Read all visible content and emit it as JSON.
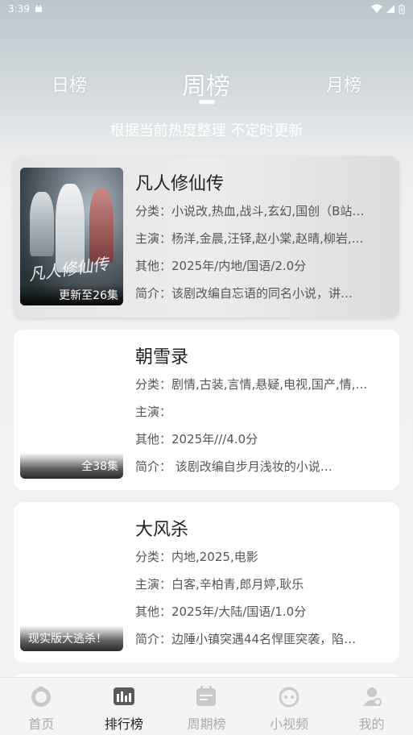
{
  "status": {
    "time": "3:39"
  },
  "tabs": [
    {
      "label": "日榜",
      "active": false
    },
    {
      "label": "周榜",
      "active": true
    },
    {
      "label": "月榜",
      "active": false
    }
  ],
  "subtitle": "根据当前热度整理 不定时更新",
  "cards": [
    {
      "title": "凡人修仙传",
      "badge": "更新至26集",
      "poster_art_text": "凡人修仙传",
      "category": "分类：小说改,热血,战斗,玄幻,国创（B站…",
      "cast": "主演：杨洋,金晨,汪铎,赵小棠,赵晴,柳岩,…",
      "other": "其他：2025年/内地/国语/2.0分",
      "intro": "简介：该剧改编自忘语的同名小说，讲…"
    },
    {
      "title": "朝雪录",
      "badge": "全38集",
      "category": "分类：剧情,古装,言情,悬疑,电视,国产,情,…",
      "cast": "主演：",
      "other": "其他：2025年///4.0分",
      "intro": "简介：        该剧改编自步月浅妆的小说…"
    },
    {
      "title": "大风杀",
      "badge": "现实版大逃杀！",
      "category": "分类：内地,2025,电影",
      "cast": "主演：白客,辛柏青,郎月婷,耿乐",
      "other": "其他：2025年/大陆/国语/1.0分",
      "intro": "简介：边陲小镇突遇44名悍匪突袭，陷…"
    }
  ],
  "nav": [
    {
      "label": "首页",
      "icon": "home-icon",
      "active": false
    },
    {
      "label": "排行榜",
      "icon": "ranking-icon",
      "active": true
    },
    {
      "label": "周期榜",
      "icon": "calendar-icon",
      "active": false
    },
    {
      "label": "小视频",
      "icon": "short-video-icon",
      "active": false
    },
    {
      "label": "我的",
      "icon": "profile-icon",
      "active": false
    }
  ],
  "colors": {
    "active_text": "#222222",
    "inactive_text": "#aaaaaa",
    "card_bg": "#ffffff"
  }
}
